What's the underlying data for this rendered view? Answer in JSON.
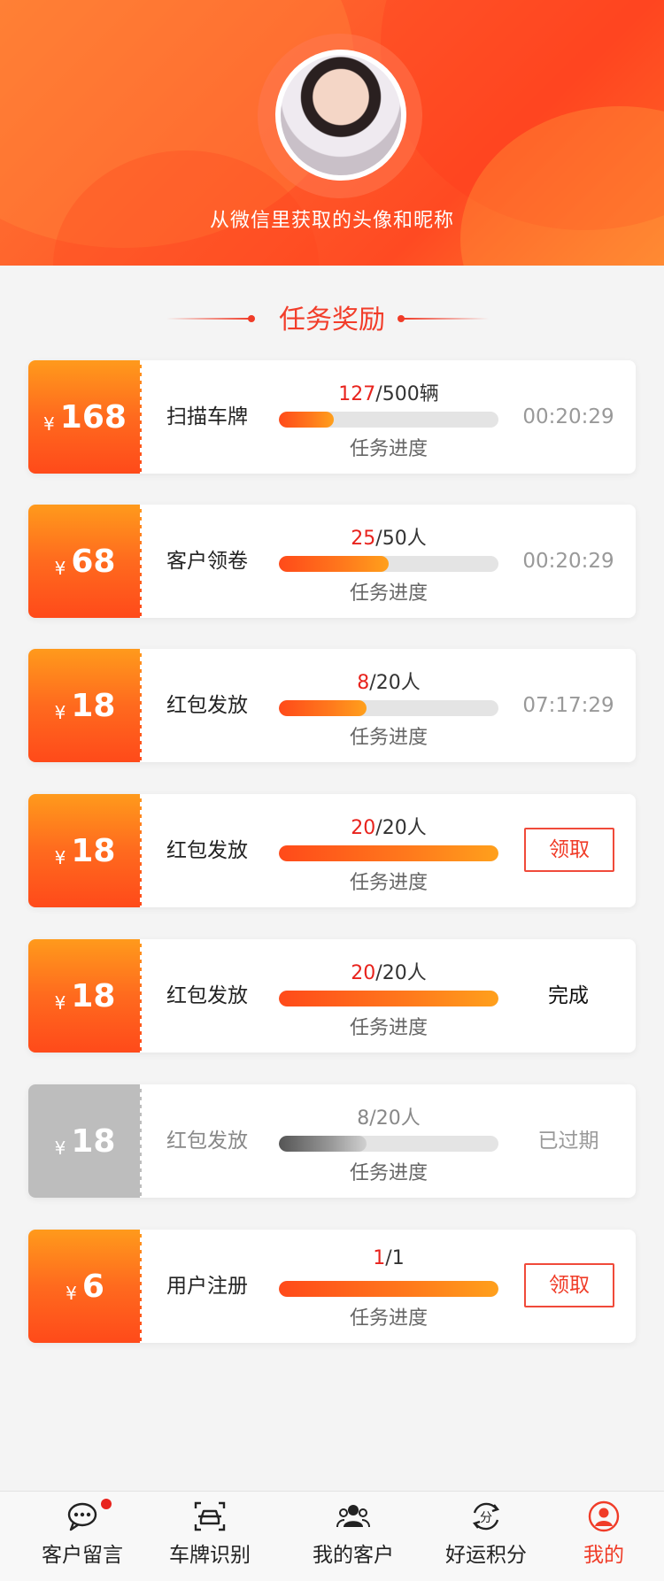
{
  "header": {
    "nickname_text": "从微信里获取的头像和昵称"
  },
  "section": {
    "title": "任务奖励"
  },
  "colors": {
    "accent": "#f03c28",
    "coupon_start": "#ff9a1c",
    "coupon_end": "#ff4a1a",
    "expired_gray": "#bdbdbd"
  },
  "tasks": [
    {
      "currency": "¥",
      "amount": "168",
      "name": "扫描车牌",
      "done": "127",
      "total": "/500辆",
      "progress": 0.254,
      "label": "任务进度",
      "right": "00:20:29",
      "state": "timer"
    },
    {
      "currency": "¥",
      "amount": "68",
      "name": "客户领卷",
      "done": "25",
      "total": "/50人",
      "progress": 0.5,
      "label": "任务进度",
      "right": "00:20:29",
      "state": "timer"
    },
    {
      "currency": "¥",
      "amount": "18",
      "name": "红包发放",
      "done": "8",
      "total": "/20人",
      "progress": 0.4,
      "label": "任务进度",
      "right": "07:17:29",
      "state": "timer"
    },
    {
      "currency": "¥",
      "amount": "18",
      "name": "红包发放",
      "done": "20",
      "total": "/20人",
      "progress": 1.0,
      "label": "任务进度",
      "right": "领取",
      "state": "claim"
    },
    {
      "currency": "¥",
      "amount": "18",
      "name": "红包发放",
      "done": "20",
      "total": "/20人",
      "progress": 1.0,
      "label": "任务进度",
      "right": "完成",
      "state": "done"
    },
    {
      "currency": "¥",
      "amount": "18",
      "name": "红包发放",
      "done": "8",
      "total": "/20人",
      "progress": 0.4,
      "label": "任务进度",
      "right": "已过期",
      "state": "expired"
    },
    {
      "currency": "¥",
      "amount": "6",
      "name": "用户注册",
      "done": "1",
      "total": "/1",
      "progress": 1.0,
      "label": "任务进度",
      "right": "领取",
      "state": "claim"
    }
  ],
  "bottom_nav": [
    {
      "label": "客户留言",
      "icon": "chat-bubble-icon",
      "badge": true,
      "active": false
    },
    {
      "label": "车牌识别",
      "icon": "car-scan-icon",
      "badge": false,
      "active": false
    },
    {
      "label": "我的客户",
      "icon": "customers-icon",
      "badge": false,
      "active": false
    },
    {
      "label": "好运积分",
      "icon": "points-icon",
      "badge": false,
      "active": false
    },
    {
      "label": "我的",
      "icon": "profile-icon",
      "badge": false,
      "active": true
    }
  ]
}
